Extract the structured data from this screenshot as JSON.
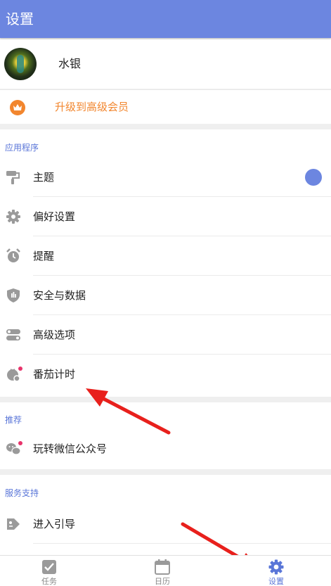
{
  "header": {
    "title": "设置"
  },
  "profile": {
    "name": "水银"
  },
  "upgrade": {
    "label": "升级到高级会员"
  },
  "sections": {
    "app": {
      "title": "应用程序",
      "items": [
        {
          "label": "主题"
        },
        {
          "label": "偏好设置"
        },
        {
          "label": "提醒"
        },
        {
          "label": "安全与数据"
        },
        {
          "label": "高级选项"
        },
        {
          "label": "番茄计时"
        }
      ]
    },
    "recommend": {
      "title": "推荐",
      "items": [
        {
          "label": "玩转微信公众号"
        }
      ]
    },
    "support": {
      "title": "服务支持",
      "items": [
        {
          "label": "进入引导"
        }
      ]
    }
  },
  "tabs": [
    {
      "label": "任务",
      "icon": "checkbox-icon"
    },
    {
      "label": "日历",
      "icon": "calendar-icon"
    },
    {
      "label": "设置",
      "icon": "gear-icon"
    }
  ],
  "colors": {
    "accent": "#6c86e0",
    "upgrade": "#f2862e",
    "badge": "#e8336b",
    "annotation_arrow": "#e8201c"
  }
}
